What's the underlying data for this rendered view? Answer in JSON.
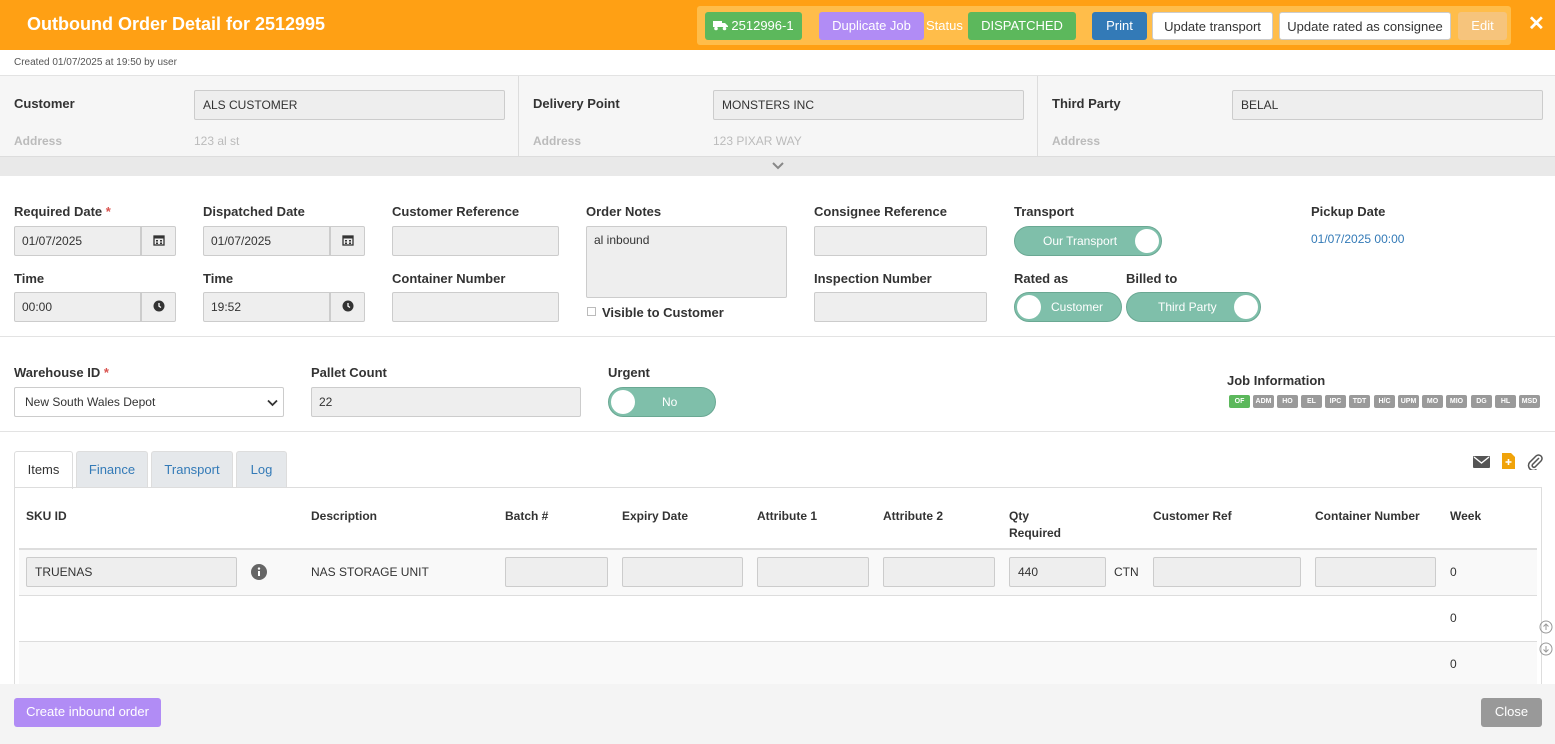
{
  "header": {
    "title": "Outbound Order Detail for 2512995",
    "job_link": "2512996-1",
    "duplicate_label": "Duplicate Job",
    "status_label": "Status",
    "status_value": "DISPATCHED",
    "print_label": "Print",
    "update_transport_label": "Update transport",
    "update_rated_label": "Update rated as consignee",
    "edit_label": "Edit",
    "close_symbol": "✕",
    "colors": {
      "bar": "#ffa014",
      "green": "#5cb85c",
      "purple": "#b18cf5",
      "blue": "#337ab7"
    }
  },
  "created_text": "Created 01/07/2025 at 19:50 by user",
  "parties": {
    "customer": {
      "label": "Customer",
      "value": "ALS CUSTOMER",
      "address_label": "Address",
      "address": "123 al st"
    },
    "delivery": {
      "label": "Delivery Point",
      "value": "MONSTERS INC",
      "address_label": "Address",
      "address": "123 PIXAR WAY"
    },
    "third_party": {
      "label": "Third Party",
      "value": "BELAL",
      "address_label": "Address"
    }
  },
  "form": {
    "required_date": {
      "label": "Required Date",
      "required_mark": "*",
      "value": "01/07/2025"
    },
    "dispatched_date": {
      "label": "Dispatched Date",
      "value": "01/07/2025"
    },
    "customer_reference": {
      "label": "Customer Reference",
      "value": ""
    },
    "order_notes": {
      "label": "Order Notes",
      "value": "al inbound"
    },
    "visible_to_customer": {
      "label": "Visible to Customer",
      "checked": false
    },
    "consignee_reference": {
      "label": "Consignee Reference",
      "value": ""
    },
    "transport": {
      "label": "Transport",
      "value": "Our Transport"
    },
    "pickup_date": {
      "label": "Pickup Date",
      "value": "01/07/2025 00:00"
    },
    "time1": {
      "label": "Time",
      "value": "00:00"
    },
    "time2": {
      "label": "Time",
      "value": "19:52"
    },
    "container_number": {
      "label": "Container Number",
      "value": ""
    },
    "inspection_number": {
      "label": "Inspection Number",
      "value": ""
    },
    "rated_as": {
      "label": "Rated as",
      "value": "Customer"
    },
    "billed_to": {
      "label": "Billed to",
      "value": "Third Party"
    },
    "warehouse_id": {
      "label": "Warehouse ID",
      "required_mark": "*",
      "value": "New South Wales Depot"
    },
    "pallet_count": {
      "label": "Pallet Count",
      "value": "22"
    },
    "urgent": {
      "label": "Urgent",
      "value": "No"
    },
    "job_information": {
      "label": "Job Information",
      "chips": [
        "OF",
        "ADM",
        "HO",
        "EL",
        "IPC",
        "TDT",
        "H/C",
        "UPM",
        "MO",
        "MIO",
        "DG",
        "HL",
        "MSD"
      ],
      "active_chip": "OF"
    }
  },
  "tabs": [
    "Items",
    "Finance",
    "Transport",
    "Log"
  ],
  "active_tab": "Items",
  "tab_icons": [
    "envelope-icon",
    "add-file-icon",
    "paperclip-icon"
  ],
  "table": {
    "headers": {
      "sku": "SKU ID",
      "description": "Description",
      "batch": "Batch #",
      "expiry": "Expiry Date",
      "attr1": "Attribute 1",
      "attr2": "Attribute 2",
      "qty1": "Qty",
      "qty2": "Required",
      "customer_ref": "Customer Ref",
      "container": "Container Number",
      "week": "Week"
    },
    "rows": [
      {
        "sku": "TRUENAS",
        "description": "NAS STORAGE UNIT",
        "batch": "",
        "expiry": "",
        "attr1": "",
        "attr2": "",
        "qty": "440",
        "unit": "CTN",
        "customer_ref": "",
        "container": "",
        "week": "0"
      },
      {
        "week": "0"
      },
      {
        "week": "0"
      }
    ]
  },
  "footer": {
    "create_inbound_label": "Create inbound order",
    "close_label": "Close"
  }
}
